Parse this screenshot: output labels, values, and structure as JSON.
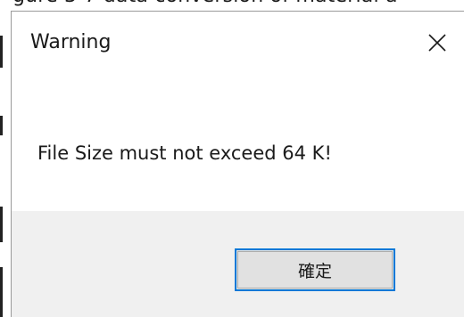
{
  "background": {
    "cropped_text": "gure 3-7 data conversion of material a"
  },
  "dialog": {
    "title": "Warning",
    "close_icon": "close-icon",
    "message": "File Size must not exceed 64 K!",
    "ok_button_label": "確定",
    "colors": {
      "footer_bg": "#f0f0f0",
      "button_border_focus": "#0078d7",
      "button_bg": "#e1e1e1"
    }
  }
}
